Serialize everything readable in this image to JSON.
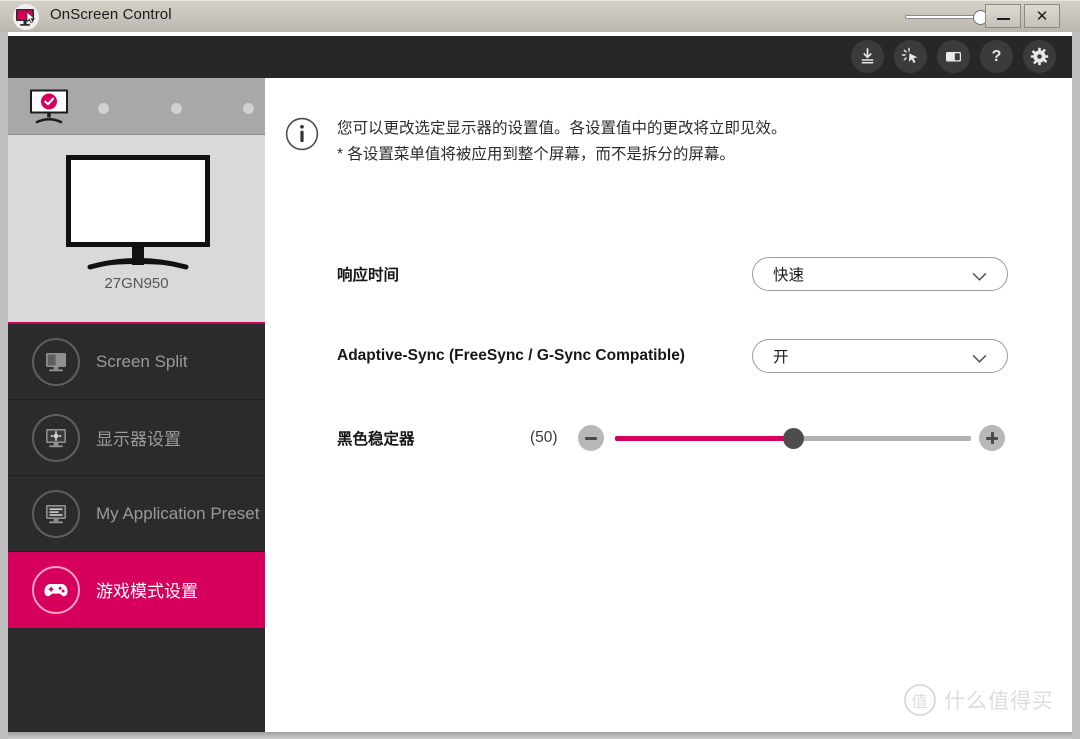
{
  "window": {
    "title": "OnScreen Control",
    "logo_icon": "monitor-cursor-logo-icon",
    "opacity_slider_value": "80",
    "minimize_label": "—",
    "close_label": "✕"
  },
  "toolbar": {
    "icons": [
      {
        "name": "software-update-icon",
        "glyph": "⤓"
      },
      {
        "name": "click-pointer-icon",
        "glyph": "✦"
      },
      {
        "name": "screen-split-icon",
        "glyph": "▣"
      },
      {
        "name": "help-icon",
        "glyph": "?"
      },
      {
        "name": "settings-gear-icon",
        "glyph": "⚙"
      }
    ]
  },
  "sidebar": {
    "monitor_tabs": {
      "selected_icon": "monitor-checked-icon",
      "empty_slots": 3
    },
    "monitor_preview": {
      "model_name": "27GN950",
      "icon": "monitor-preview-icon"
    },
    "items": [
      {
        "label": "Screen Split",
        "icon": "screen-split-icon",
        "active": false
      },
      {
        "label": "显示器设置",
        "icon": "monitor-settings-icon",
        "active": false
      },
      {
        "label": "My Application Preset",
        "icon": "application-preset-icon",
        "active": false
      },
      {
        "label": "游戏模式设置",
        "icon": "gamepad-icon",
        "active": true
      }
    ]
  },
  "content": {
    "info": {
      "icon": "info-icon",
      "line1": "您可以更改选定显示器的设置值。各设置值中的更改将立即见效。",
      "line2": "* 各设置菜单值将被应用到整个屏幕，而不是拆分的屏幕。"
    },
    "settings": [
      {
        "type": "dropdown",
        "label": "响应时间",
        "value": "快速"
      },
      {
        "type": "dropdown",
        "label": "Adaptive-Sync (FreeSync / G-Sync Compatible)",
        "value": "开"
      },
      {
        "type": "slider",
        "label": "黑色稳定器",
        "value_text": "(50)",
        "value": 50,
        "min": 0,
        "max": 100,
        "minus_label": "−",
        "plus_label": "+"
      }
    ]
  },
  "watermark": {
    "badge": "值",
    "text": "什么值得买"
  },
  "colors": {
    "accent": "#D6005C",
    "sidebar_bg": "#2B2B2B",
    "toolbar_bg": "#272727",
    "content_bg": "#FFFFFF"
  }
}
